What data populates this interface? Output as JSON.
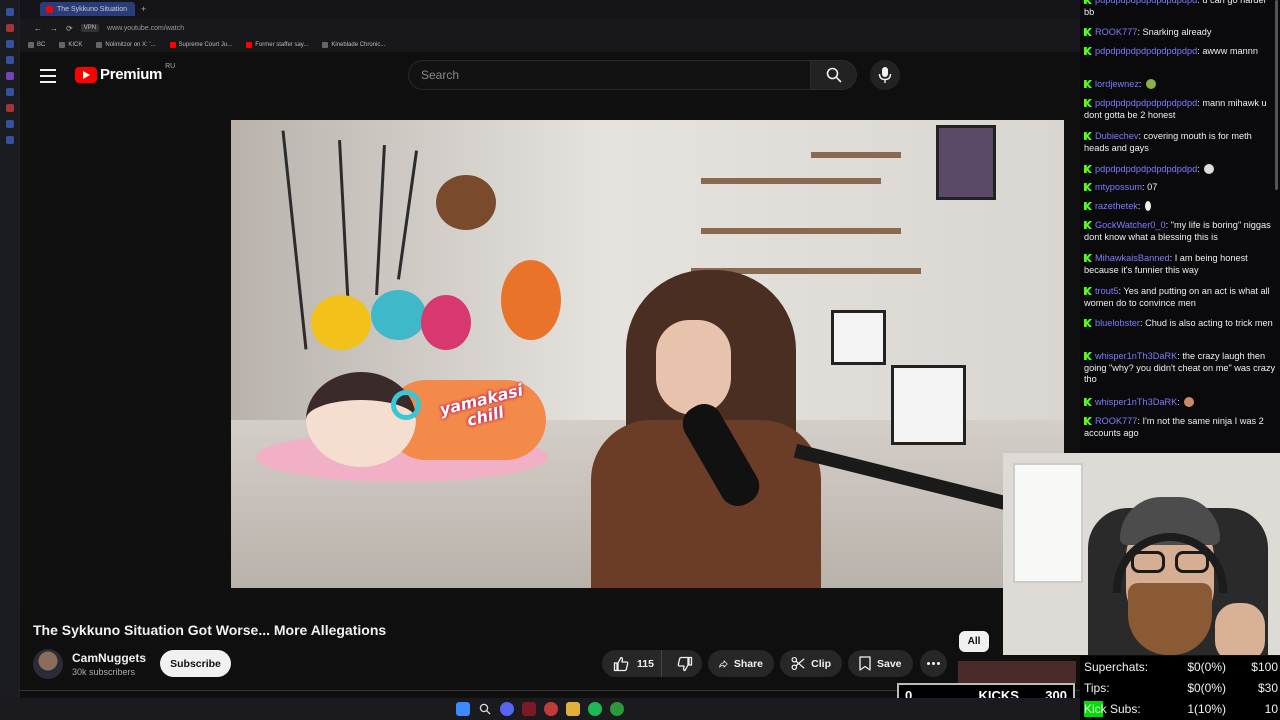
{
  "browser": {
    "tab_title": "The Sykkuno Situation",
    "url": "www.youtube.com/watch",
    "vpn_label": "VPN",
    "bookmarks": [
      "BC",
      "KICK",
      "Nolimitzor on X: '...",
      "Supreme Court Ju...",
      "Former staffer say...",
      "Kineblade Chronic..."
    ]
  },
  "header": {
    "logo_text": "Premium",
    "region": "RU",
    "search_placeholder": "Search"
  },
  "video": {
    "title": "The Sykkuno Situation Got Worse... More Allegations",
    "overlay_text_line1": "yamakasi",
    "overlay_text_line2": "chill"
  },
  "channel": {
    "name": "CamNuggets",
    "subscribers": "30k subscribers",
    "subscribe_label": "Subscribe"
  },
  "actions": {
    "like_count": "115",
    "share_label": "Share",
    "clip_label": "Clip",
    "save_label": "Save"
  },
  "chips": {
    "all_label": "All"
  },
  "chat": {
    "messages": [
      {
        "user": "pdpdpdpdpdpdpdpdpdpd",
        "text": "u can go harder bb"
      },
      {
        "user": "ROOK777",
        "text": "Snarking already"
      },
      {
        "user": "pdpdpdpdpdpdpdpdpdpd",
        "text": "awww mannn"
      },
      {
        "user": "lordjewnez",
        "text": ""
      },
      {
        "user": "pdpdpdpdpdpdpdpdpdpd",
        "text": "mann mihawk u dont gotta be 2 honest"
      },
      {
        "user": "Dubiechev",
        "text": "covering mouth is for meth heads and gays"
      },
      {
        "user": "pdpdpdpdpdpdpdpdpdpd",
        "text": ""
      },
      {
        "user": "mtypossum",
        "text": "07"
      },
      {
        "user": "razethetek",
        "text": ""
      },
      {
        "user": "GockWatcher0_0",
        "text": "\"my life is boring\" niggas dont know what a blessing this is"
      },
      {
        "user": "MihawkaisBanned",
        "text": "I am being honest because it's funnier this way"
      },
      {
        "user": "trout5",
        "text": "Yes and putting on an act is what all women do to convince men"
      },
      {
        "user": "bluelobster",
        "text": "Chud is also acting to trick men"
      },
      {
        "user": "whisper1nTh3DaRK",
        "text": "the crazy laugh then going \"why? you didn't cheat on me\" was crazy tho"
      },
      {
        "user": "whisper1nTh3DaRK",
        "text": ""
      },
      {
        "user": "ROOK777",
        "text": "I'm not the same ninja I was 2 accounts ago"
      }
    ]
  },
  "kicks": {
    "left_value": "0",
    "label": "KICKS",
    "goal": "300",
    "progress": 0
  },
  "stats": {
    "rows": [
      {
        "label": "Superchats:",
        "value": "$0(0%)",
        "goal": "$100",
        "fill_fraction": 0
      },
      {
        "label": "Tips:",
        "value": "$0(0%)",
        "goal": "$30",
        "fill_fraction": 0
      },
      {
        "label": "Kick Subs:",
        "value": "1(10%)",
        "goal": "10",
        "fill_fraction": 0.1
      }
    ]
  },
  "colors": {
    "kick_green": "#53fc18",
    "youtube_red": "#ff0000",
    "chat_username": "#7e7cff"
  }
}
